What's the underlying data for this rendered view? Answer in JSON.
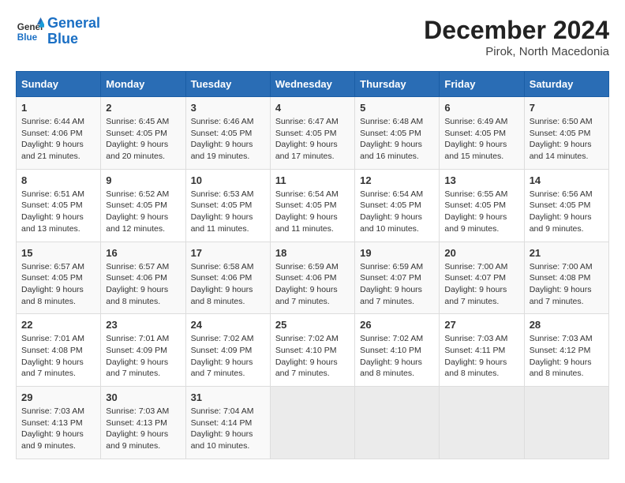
{
  "header": {
    "logo_line1": "General",
    "logo_line2": "Blue",
    "month_year": "December 2024",
    "location": "Pirok, North Macedonia"
  },
  "weekdays": [
    "Sunday",
    "Monday",
    "Tuesday",
    "Wednesday",
    "Thursday",
    "Friday",
    "Saturday"
  ],
  "weeks": [
    [
      {
        "day": "1",
        "sunrise": "Sunrise: 6:44 AM",
        "sunset": "Sunset: 4:06 PM",
        "daylight": "Daylight: 9 hours and 21 minutes."
      },
      {
        "day": "2",
        "sunrise": "Sunrise: 6:45 AM",
        "sunset": "Sunset: 4:05 PM",
        "daylight": "Daylight: 9 hours and 20 minutes."
      },
      {
        "day": "3",
        "sunrise": "Sunrise: 6:46 AM",
        "sunset": "Sunset: 4:05 PM",
        "daylight": "Daylight: 9 hours and 19 minutes."
      },
      {
        "day": "4",
        "sunrise": "Sunrise: 6:47 AM",
        "sunset": "Sunset: 4:05 PM",
        "daylight": "Daylight: 9 hours and 17 minutes."
      },
      {
        "day": "5",
        "sunrise": "Sunrise: 6:48 AM",
        "sunset": "Sunset: 4:05 PM",
        "daylight": "Daylight: 9 hours and 16 minutes."
      },
      {
        "day": "6",
        "sunrise": "Sunrise: 6:49 AM",
        "sunset": "Sunset: 4:05 PM",
        "daylight": "Daylight: 9 hours and 15 minutes."
      },
      {
        "day": "7",
        "sunrise": "Sunrise: 6:50 AM",
        "sunset": "Sunset: 4:05 PM",
        "daylight": "Daylight: 9 hours and 14 minutes."
      }
    ],
    [
      {
        "day": "8",
        "sunrise": "Sunrise: 6:51 AM",
        "sunset": "Sunset: 4:05 PM",
        "daylight": "Daylight: 9 hours and 13 minutes."
      },
      {
        "day": "9",
        "sunrise": "Sunrise: 6:52 AM",
        "sunset": "Sunset: 4:05 PM",
        "daylight": "Daylight: 9 hours and 12 minutes."
      },
      {
        "day": "10",
        "sunrise": "Sunrise: 6:53 AM",
        "sunset": "Sunset: 4:05 PM",
        "daylight": "Daylight: 9 hours and 11 minutes."
      },
      {
        "day": "11",
        "sunrise": "Sunrise: 6:54 AM",
        "sunset": "Sunset: 4:05 PM",
        "daylight": "Daylight: 9 hours and 11 minutes."
      },
      {
        "day": "12",
        "sunrise": "Sunrise: 6:54 AM",
        "sunset": "Sunset: 4:05 PM",
        "daylight": "Daylight: 9 hours and 10 minutes."
      },
      {
        "day": "13",
        "sunrise": "Sunrise: 6:55 AM",
        "sunset": "Sunset: 4:05 PM",
        "daylight": "Daylight: 9 hours and 9 minutes."
      },
      {
        "day": "14",
        "sunrise": "Sunrise: 6:56 AM",
        "sunset": "Sunset: 4:05 PM",
        "daylight": "Daylight: 9 hours and 9 minutes."
      }
    ],
    [
      {
        "day": "15",
        "sunrise": "Sunrise: 6:57 AM",
        "sunset": "Sunset: 4:05 PM",
        "daylight": "Daylight: 9 hours and 8 minutes."
      },
      {
        "day": "16",
        "sunrise": "Sunrise: 6:57 AM",
        "sunset": "Sunset: 4:06 PM",
        "daylight": "Daylight: 9 hours and 8 minutes."
      },
      {
        "day": "17",
        "sunrise": "Sunrise: 6:58 AM",
        "sunset": "Sunset: 4:06 PM",
        "daylight": "Daylight: 9 hours and 8 minutes."
      },
      {
        "day": "18",
        "sunrise": "Sunrise: 6:59 AM",
        "sunset": "Sunset: 4:06 PM",
        "daylight": "Daylight: 9 hours and 7 minutes."
      },
      {
        "day": "19",
        "sunrise": "Sunrise: 6:59 AM",
        "sunset": "Sunset: 4:07 PM",
        "daylight": "Daylight: 9 hours and 7 minutes."
      },
      {
        "day": "20",
        "sunrise": "Sunrise: 7:00 AM",
        "sunset": "Sunset: 4:07 PM",
        "daylight": "Daylight: 9 hours and 7 minutes."
      },
      {
        "day": "21",
        "sunrise": "Sunrise: 7:00 AM",
        "sunset": "Sunset: 4:08 PM",
        "daylight": "Daylight: 9 hours and 7 minutes."
      }
    ],
    [
      {
        "day": "22",
        "sunrise": "Sunrise: 7:01 AM",
        "sunset": "Sunset: 4:08 PM",
        "daylight": "Daylight: 9 hours and 7 minutes."
      },
      {
        "day": "23",
        "sunrise": "Sunrise: 7:01 AM",
        "sunset": "Sunset: 4:09 PM",
        "daylight": "Daylight: 9 hours and 7 minutes."
      },
      {
        "day": "24",
        "sunrise": "Sunrise: 7:02 AM",
        "sunset": "Sunset: 4:09 PM",
        "daylight": "Daylight: 9 hours and 7 minutes."
      },
      {
        "day": "25",
        "sunrise": "Sunrise: 7:02 AM",
        "sunset": "Sunset: 4:10 PM",
        "daylight": "Daylight: 9 hours and 7 minutes."
      },
      {
        "day": "26",
        "sunrise": "Sunrise: 7:02 AM",
        "sunset": "Sunset: 4:10 PM",
        "daylight": "Daylight: 9 hours and 8 minutes."
      },
      {
        "day": "27",
        "sunrise": "Sunrise: 7:03 AM",
        "sunset": "Sunset: 4:11 PM",
        "daylight": "Daylight: 9 hours and 8 minutes."
      },
      {
        "day": "28",
        "sunrise": "Sunrise: 7:03 AM",
        "sunset": "Sunset: 4:12 PM",
        "daylight": "Daylight: 9 hours and 8 minutes."
      }
    ],
    [
      {
        "day": "29",
        "sunrise": "Sunrise: 7:03 AM",
        "sunset": "Sunset: 4:13 PM",
        "daylight": "Daylight: 9 hours and 9 minutes."
      },
      {
        "day": "30",
        "sunrise": "Sunrise: 7:03 AM",
        "sunset": "Sunset: 4:13 PM",
        "daylight": "Daylight: 9 hours and 9 minutes."
      },
      {
        "day": "31",
        "sunrise": "Sunrise: 7:04 AM",
        "sunset": "Sunset: 4:14 PM",
        "daylight": "Daylight: 9 hours and 10 minutes."
      },
      null,
      null,
      null,
      null
    ]
  ]
}
